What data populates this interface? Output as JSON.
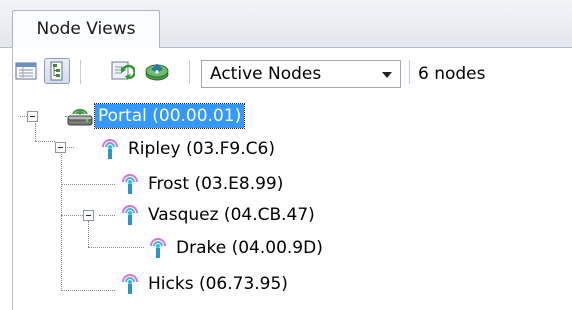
{
  "panel": {
    "tab_label": "Node Views"
  },
  "toolbar": {
    "view_mode_dropdown": {
      "selected": "Active Nodes"
    },
    "node_count": "6 nodes"
  },
  "tree": {
    "nodes": [
      {
        "label": "Portal (00.00.01)",
        "icon": "router-icon",
        "selected": true,
        "expanded": true
      },
      {
        "label": "Ripley (03.F9.C6)",
        "icon": "wireless-node-icon",
        "expanded": true
      },
      {
        "label": "Frost (03.E8.99)",
        "icon": "wireless-node-icon"
      },
      {
        "label": "Vasquez (04.CB.47)",
        "icon": "wireless-node-icon",
        "expanded": true
      },
      {
        "label": "Drake (04.00.9D)",
        "icon": "wireless-node-icon"
      },
      {
        "label": "Hicks (06.73.95)",
        "icon": "wireless-node-icon"
      }
    ]
  },
  "colors": {
    "selection": "#3399ff",
    "antenna_pink": "#e06fd2",
    "antenna_cyan": "#3ab7e8",
    "router_green": "#3f9a3a"
  }
}
